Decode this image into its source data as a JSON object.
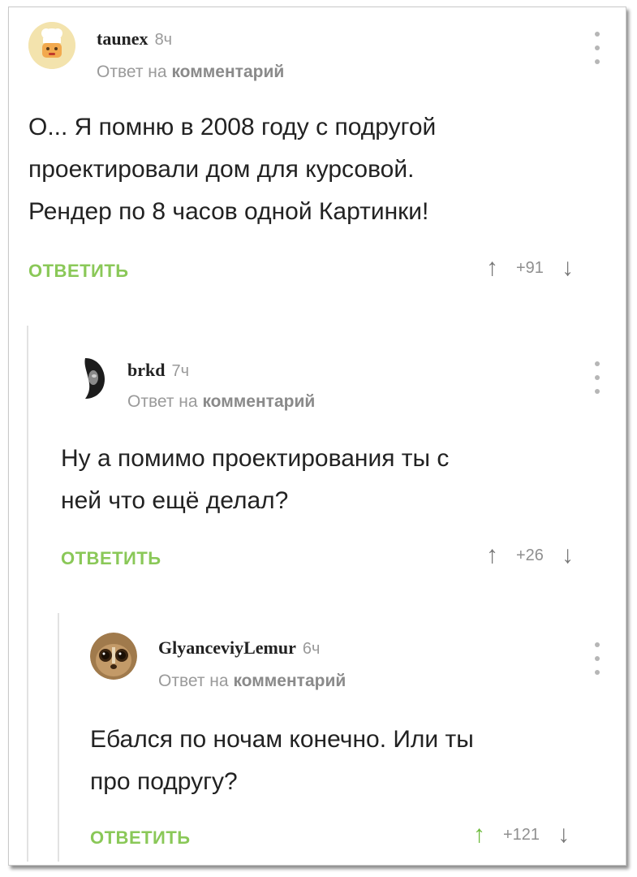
{
  "reply_subline_prefix": "Ответ на",
  "reply_subline_link": "комментарий",
  "reply_label": "ОТВЕТИТЬ",
  "comments": [
    {
      "username": "taunex",
      "time": "8ч",
      "text_lines": [
        "О... Я помню в 2008 году с подругой",
        "проектировали дом для курсовой.",
        "Рендер по 8 часов одной Картинки!"
      ],
      "score": "+91",
      "upvoted": false
    },
    {
      "username": "brkd",
      "time": "7ч",
      "text_lines": [
        "Ну а помимо проектирования ты с",
        "ней что ещё делал?"
      ],
      "score": "+26",
      "upvoted": false
    },
    {
      "username": "GlyanceviyLemur",
      "time": "6ч",
      "text_lines": [
        "Ебался по ночам конечно. Или ты",
        "про подругу?"
      ],
      "score": "+121",
      "upvoted": true
    }
  ],
  "colors": {
    "reply_green": "#8ac858",
    "upvote_active": "#6dbb3c",
    "muted_text": "#9a9a9a"
  },
  "icons": [
    "chef-avatar-icon",
    "more-options-icon",
    "arrow-up-icon",
    "arrow-down-icon"
  ]
}
